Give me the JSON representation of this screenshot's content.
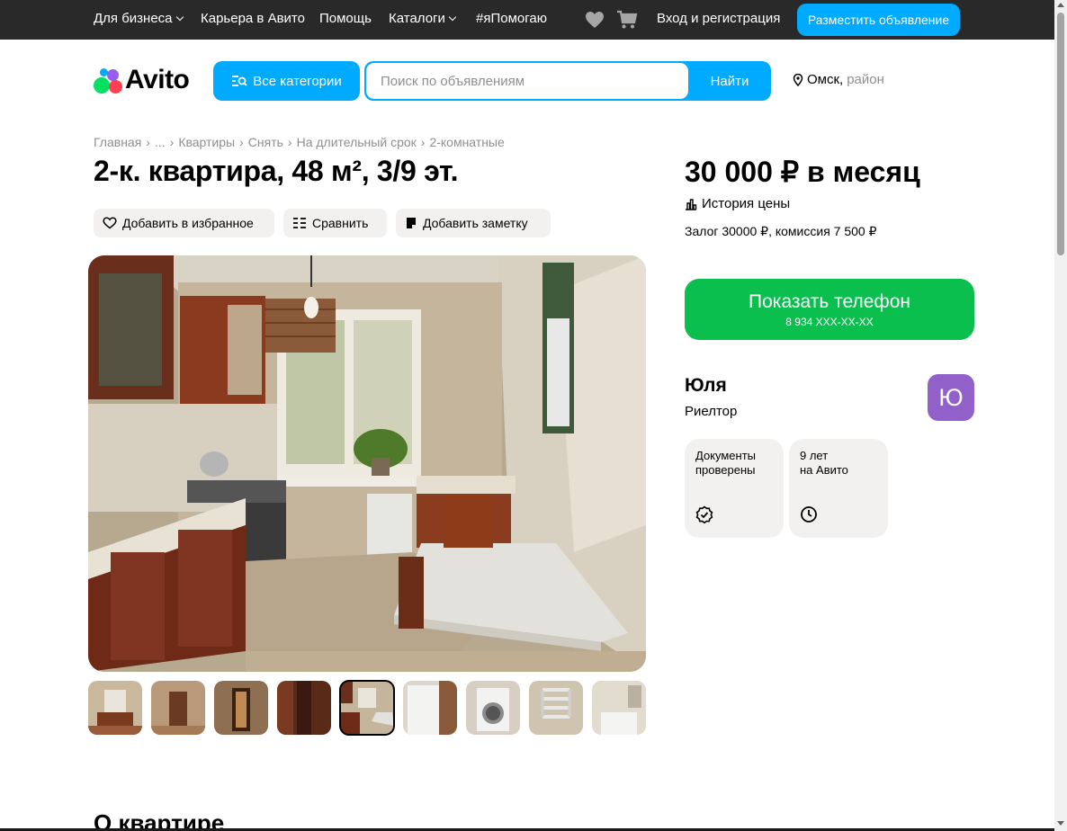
{
  "topbar": {
    "business": "Для бизнеса",
    "career": "Карьера в Авито",
    "help": "Помощь",
    "catalogs": "Каталоги",
    "iHelp": "#яПомогаю",
    "login": "Вход и регистрация",
    "post_ad": "Разместить объявление",
    "favorites_icon": "heart-icon",
    "cart_icon": "cart-icon"
  },
  "header": {
    "logo_text": "Avito",
    "categories_button": "Все категории",
    "search_placeholder": "Поиск по объявлениям",
    "search_value": "",
    "search_button": "Найти",
    "city": "Омск,",
    "district": "район"
  },
  "breadcrumbs": [
    "Главная",
    "...",
    "Квартиры",
    "Снять",
    "На длительный срок",
    "2-комнатные"
  ],
  "listing": {
    "title": "2-к. квартира, 48 м², 3/9 эт.",
    "actions": {
      "favorite": "Добавить в избранное",
      "compare": "Сравнить",
      "note": "Добавить заметку"
    },
    "gallery": {
      "thumb_count": 9,
      "active_thumb": 5
    },
    "section_title": "О квартире"
  },
  "sidebar": {
    "price": "30 000 ₽ в месяц",
    "price_history": "История цены",
    "deposit": "Залог 30000 ₽, комиссия 7 500 ₽",
    "phone_button": "Показать телефон",
    "phone_masked": "8 934 XXX-XX-XX",
    "seller": {
      "name": "Юля",
      "role": "Риелтор",
      "avatar_letter": "Ю"
    },
    "badges": [
      {
        "line1": "Документы",
        "line2": "проверены",
        "icon": "verified-icon"
      },
      {
        "line1": "9 лет",
        "line2": "на Авито",
        "icon": "clock-icon"
      }
    ]
  },
  "colors": {
    "topbar": "#292929",
    "accent_blue": "#00aaff",
    "phone_green": "#0bbf4f",
    "avatar_purple": "#9160c9",
    "chip_gray": "#f2f1f0"
  }
}
